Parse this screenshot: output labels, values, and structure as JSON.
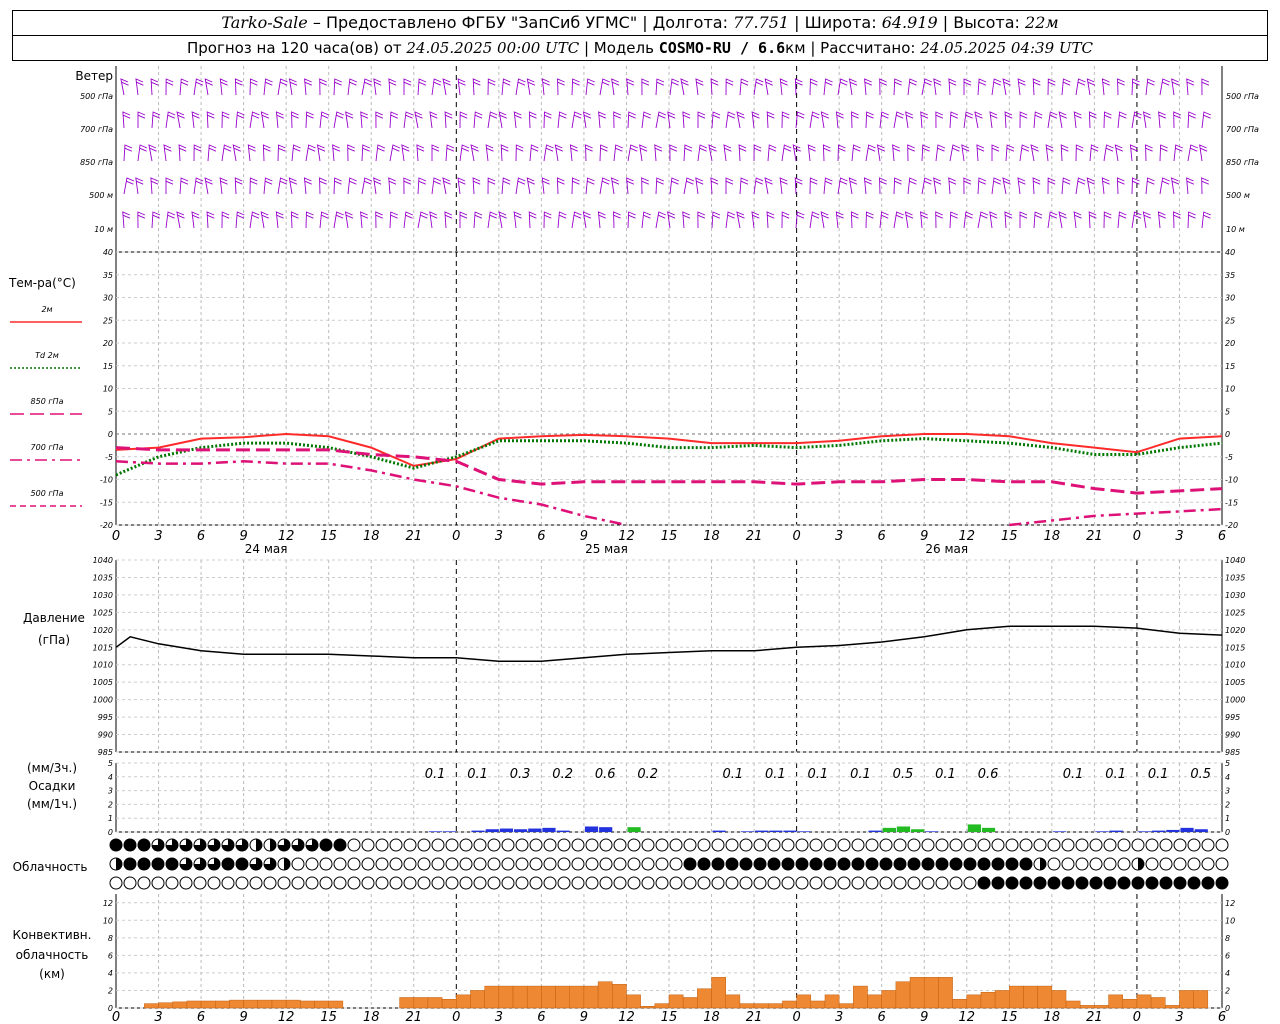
{
  "header": {
    "station": "Tarko-Sale",
    "provider": "– Предоставлено ФГБУ \"ЗапСиб УГМС\"",
    "lon_label": "Долгота:",
    "lon": "77.751",
    "lat_label": "Широта:",
    "lat": "64.919",
    "alt_label": "Высота:",
    "alt": "22м",
    "fc_label": "Прогноз на 120 часа(ов) от",
    "fc_time": "24.05.2025 00:00 UTC",
    "model_label": "| Модель",
    "model": "COSMO-RU / 6.6",
    "model_unit": "км",
    "calc_label": "| Рассчитано:",
    "calc_time": "24.05.2025 04:39 UTC"
  },
  "wind_panel": {
    "title": "Ветер",
    "levels": [
      "500 гПа",
      "700 гПа",
      "850 гПа",
      "500 м",
      "10 м"
    ],
    "color": "#9900cc"
  },
  "temp_panel": {
    "title": "Тем-ра(°C)",
    "legend": [
      {
        "label": "2м",
        "color": "#ff2a2a",
        "style": "solid"
      },
      {
        "label": "Td  2м",
        "color": "#007700",
        "style": "dotted"
      },
      {
        "label": "850  гПа",
        "color": "#dd1177",
        "style": "long-dash"
      },
      {
        "label": "700  гПа",
        "color": "#dd1177",
        "style": "dash-dot"
      },
      {
        "label": "500  гПа",
        "color": "#dd1177",
        "style": "short-dash"
      }
    ]
  },
  "pressure_panel": {
    "title": "Давление",
    "unit": "(гПа)"
  },
  "precip_panel": {
    "unit_top": "(мм/3ч.)",
    "title": "Осадки",
    "unit_bottom": "(мм/1ч.)"
  },
  "cloud_panel": {
    "title": "Облачность"
  },
  "conv_panel": {
    "title1": "Конвективн.",
    "title2": "облачность",
    "unit": "(км)"
  },
  "chart_data": {
    "type": "line",
    "x_hours_ticks": [
      "0",
      "3",
      "6",
      "9",
      "12",
      "15",
      "18",
      "21",
      "0",
      "3",
      "6",
      "9",
      "12",
      "15",
      "18",
      "21",
      "0",
      "3",
      "6",
      "9",
      "12",
      "15",
      "18",
      "21",
      "0",
      "3",
      "6"
    ],
    "day_labels": [
      "24 мая",
      "25 мая",
      "26 мая"
    ],
    "temperature": {
      "ylim": [
        -20,
        40
      ],
      "yticks": [
        40,
        35,
        30,
        25,
        20,
        15,
        10,
        5,
        0,
        -5,
        -10,
        -15,
        -20
      ],
      "hours": [
        0,
        3,
        6,
        9,
        12,
        15,
        18,
        21,
        24,
        27,
        30,
        33,
        36,
        39,
        42,
        45,
        48,
        51,
        54,
        57,
        60,
        63,
        66,
        69,
        72,
        75,
        78
      ],
      "series": [
        {
          "name": "2м",
          "values": [
            -3.5,
            -3,
            -1,
            -0.7,
            0,
            -0.5,
            -3,
            -7,
            -5.5,
            -1,
            -0.5,
            -0.2,
            -0.5,
            -1,
            -2,
            -2,
            -2,
            -1.5,
            -0.5,
            0,
            0,
            -0.5,
            -2,
            -3,
            -4,
            -1,
            -0.5
          ]
        },
        {
          "name": "Td  2м",
          "values": [
            -9,
            -5,
            -3,
            -2,
            -2,
            -3,
            -5,
            -7.5,
            -5,
            -1.5,
            -1.5,
            -1.5,
            -2,
            -3,
            -3,
            -2.5,
            -3,
            -2.5,
            -1.5,
            -1,
            -1.5,
            -2,
            -3,
            -4.5,
            -4.5,
            -3,
            -2
          ]
        },
        {
          "name": "850  гПа",
          "values": [
            -3,
            -3.5,
            -3.5,
            -3.5,
            -3.5,
            -3.5,
            -4.5,
            -5,
            -6,
            -10,
            -11,
            -10.5,
            -10.5,
            -10.5,
            -10.5,
            -10.5,
            -11,
            -10.5,
            -10.5,
            -10,
            -10,
            -10.5,
            -10.5,
            -12,
            -13,
            -12.5,
            -12
          ]
        },
        {
          "name": "700  гПа",
          "values": [
            -6,
            -6.5,
            -6.5,
            -6,
            -6.5,
            -6.5,
            -8,
            -10,
            -11.5,
            -14,
            -15.5,
            -18,
            -20,
            null,
            null,
            null,
            null,
            null,
            null,
            null,
            null,
            -20,
            -19,
            -18,
            -17.5,
            -17,
            -16.5
          ]
        },
        {
          "name": "500  гПа",
          "values": [
            null,
            -20,
            null,
            null,
            -20,
            null,
            null,
            null,
            null,
            null,
            null,
            null,
            null,
            null,
            null,
            null,
            null,
            null,
            null,
            null,
            null,
            null,
            null,
            null,
            null,
            null,
            null
          ]
        }
      ]
    },
    "pressure": {
      "ylim": [
        985,
        1040
      ],
      "yticks": [
        1040,
        1035,
        1030,
        1025,
        1020,
        1015,
        1010,
        1005,
        1000,
        995,
        990,
        985
      ],
      "hours": [
        0,
        1,
        3,
        6,
        9,
        12,
        15,
        18,
        21,
        24,
        27,
        30,
        33,
        36,
        39,
        42,
        45,
        48,
        51,
        54,
        57,
        60,
        63,
        66,
        69,
        72,
        75,
        78
      ],
      "values": [
        1015,
        1018,
        1016,
        1014,
        1013,
        1013,
        1013,
        1012.5,
        1012,
        1012,
        1011,
        1011,
        1012,
        1013,
        1013.5,
        1014,
        1014,
        1015,
        1015.5,
        1016.5,
        1018,
        1020,
        1021,
        1021,
        1021,
        1020.5,
        1019,
        1018.5
      ]
    },
    "precip_3h_labels": [
      "0.1",
      "0.1",
      "0.3",
      "0.2",
      "0.6",
      "0.2",
      "",
      "0.1",
      "0.1",
      "0.1",
      "0.1",
      "0.5",
      "0.1",
      "0.6",
      "",
      "0.1",
      "0.1",
      "0.1",
      "0.5"
    ],
    "precip_label_hours": [
      22.5,
      25.5,
      28.5,
      31.5,
      34.5,
      37.5,
      40.5,
      43.5,
      46.5,
      49.5,
      52.5,
      55.5,
      58.5,
      61.5,
      64.5,
      67.5,
      70.5,
      73.5,
      76.5
    ],
    "precip_ylim": [
      0,
      5
    ],
    "precip_1h_blue": [
      [
        23,
        0.05
      ],
      [
        24,
        0.05
      ],
      [
        26,
        0.1
      ],
      [
        27,
        0.2
      ],
      [
        28,
        0.25
      ],
      [
        29,
        0.2
      ],
      [
        30,
        0.25
      ],
      [
        31,
        0.3
      ],
      [
        32,
        0.1
      ],
      [
        34,
        0.4
      ],
      [
        35,
        0.35
      ],
      [
        37,
        0.15
      ],
      [
        43,
        0.1
      ],
      [
        45,
        0.05
      ],
      [
        46,
        0.1
      ],
      [
        47,
        0.1
      ],
      [
        48,
        0.1
      ],
      [
        49,
        0.05
      ],
      [
        54,
        0.1
      ],
      [
        55,
        0.25
      ],
      [
        56,
        0.35
      ],
      [
        58,
        0.05
      ],
      [
        61,
        0.2
      ],
      [
        67,
        0.05
      ],
      [
        70,
        0.05
      ],
      [
        71,
        0.1
      ],
      [
        73,
        0.05
      ],
      [
        74,
        0.1
      ],
      [
        75,
        0.15
      ],
      [
        76,
        0.3
      ],
      [
        77,
        0.2
      ]
    ],
    "precip_1h_green": [
      [
        37,
        0.35
      ],
      [
        55,
        0.3
      ],
      [
        56,
        0.4
      ],
      [
        57,
        0.2
      ],
      [
        61,
        0.55
      ],
      [
        62,
        0.3
      ]
    ],
    "cloud_rows": {
      "upper": "FFFEEEEEEEDDEEEFFCCCCCCCCCCCCCCCCCCCCCCCCCCCCCCCCCCCCCCCCCCCCCCCCCCCCCCCCCCCCCC",
      "middle": "DFFFFEEEFFEEDCCCCCCCCCCCCCCCCCCCCCCCCCCCCFFFFFFFFFFFFFFFFFFFFFFFFFDCCCCCCDCCCCCCCCCCCCCCCCCCFFCCCCCCCCCCCCCCCCCCDF",
      "lower": "CCCCCCCCCCCCCCCCCCCCCCCCCCCCCCCCCCCCCCCCCCCCCCCCCCCCCCCCCCCCCCFFFFFFFFFFFFFFFFFFFFFFFFFFFFFFFFFFFFFFFFFFFFFFFFFFFFFFFF"
    },
    "conv_ylim": [
      0,
      13
    ],
    "conv_yticks": [
      12,
      10,
      8,
      6,
      4,
      2,
      0
    ],
    "conv_hours": [
      3,
      4,
      5,
      6,
      7,
      8,
      9,
      10,
      11,
      12,
      13,
      14,
      15,
      16,
      17,
      18,
      19,
      20,
      21,
      22,
      23,
      24,
      25,
      26,
      27,
      28,
      29,
      30,
      31,
      32,
      33,
      34,
      35,
      36,
      37,
      38,
      39,
      40,
      41,
      42,
      43,
      44,
      45,
      46,
      47,
      48,
      49,
      50,
      51,
      52,
      53,
      54,
      55,
      56,
      57,
      58,
      59,
      60,
      61,
      62,
      63,
      64,
      65,
      66,
      67,
      68,
      69,
      70,
      71,
      72,
      73,
      74,
      75,
      76,
      77
    ],
    "conv_values": [
      0.5,
      0.6,
      0.7,
      0.8,
      0.8,
      0.8,
      0.9,
      0.9,
      0.9,
      0.9,
      0.9,
      0.8,
      0.8,
      0.8,
      0,
      0,
      0,
      0,
      1.2,
      1.2,
      1.2,
      1,
      1.5,
      2,
      2.5,
      2.5,
      2.5,
      2.5,
      2.5,
      2.5,
      2.5,
      2.5,
      3,
      2.7,
      1.5,
      0.2,
      0.5,
      1.5,
      1.2,
      2.2,
      3.5,
      1.5,
      0.5,
      0.5,
      0.5,
      0.8,
      1.5,
      0.8,
      1.5,
      0.5,
      2.5,
      1.5,
      2,
      3,
      3.5,
      3.5,
      3.5,
      1,
      1.5,
      1.8,
      2,
      2.5,
      2.5,
      2.5,
      2,
      0.8,
      0.3,
      0.3,
      1.5,
      1,
      1.5,
      1.2,
      0.3,
      2,
      2
    ]
  }
}
